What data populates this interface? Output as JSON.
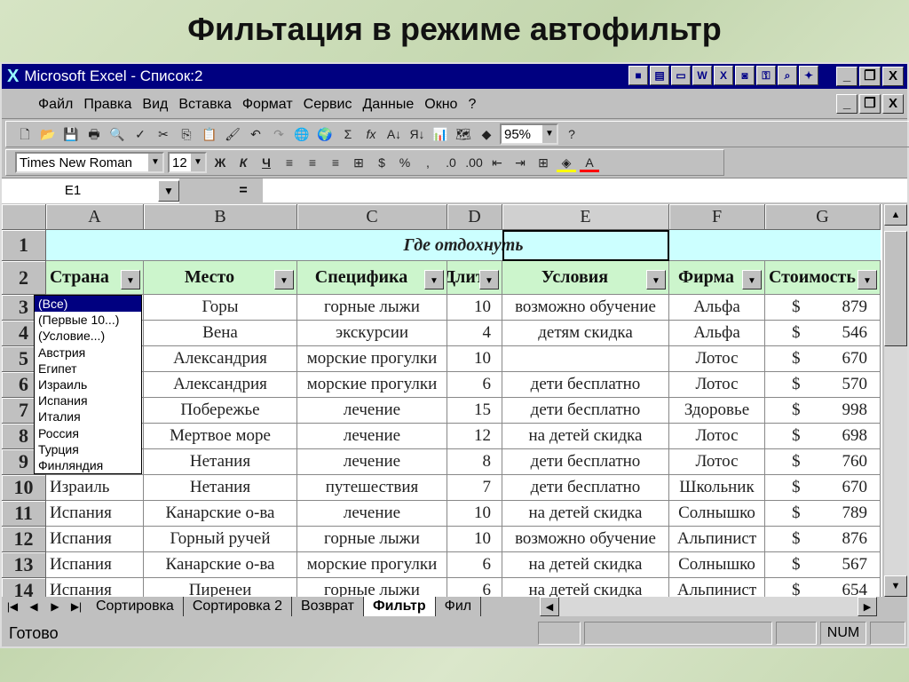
{
  "slide_title": "Фильтация в режиме автофильтр",
  "window": {
    "title": "Microsoft Excel - Список:2"
  },
  "menu": [
    "Файл",
    "Правка",
    "Вид",
    "Вставка",
    "Формат",
    "Сервис",
    "Данные",
    "Окно",
    "?"
  ],
  "toolbar": {
    "zoom": "95%",
    "font": "Times New Roman",
    "size": "12",
    "bold": "Ж",
    "italic": "К",
    "underline": "Ч",
    "percent": "%",
    "comma": ",",
    "sigma": "Σ",
    "fx": "fx"
  },
  "formula_bar": {
    "name_box": "E1",
    "equals": "=",
    "value": ""
  },
  "columns": [
    "A",
    "B",
    "C",
    "D",
    "E",
    "F",
    "G"
  ],
  "table_title": "Где отдохнуть",
  "headers": [
    "Страна",
    "Место",
    "Специфика",
    "Длит",
    "Условия",
    "Фирма",
    "Стоимость"
  ],
  "rows": [
    [
      "",
      "Горы",
      "горные лыжи",
      "10",
      "возможно обучение",
      "Альфа",
      "$",
      "879"
    ],
    [
      "",
      "Вена",
      "экскурсии",
      "4",
      "детям скидка",
      "Альфа",
      "$",
      "546"
    ],
    [
      "",
      "Александрия",
      "морские прогулки",
      "10",
      "",
      "Лотос",
      "$",
      "670"
    ],
    [
      "",
      "Александрия",
      "морские прогулки",
      "6",
      "дети бесплатно",
      "Лотос",
      "$",
      "570"
    ],
    [
      "",
      "Побережье",
      "лечение",
      "15",
      "дети бесплатно",
      "Здоровье",
      "$",
      "998"
    ],
    [
      "",
      "Мертвое море",
      "лечение",
      "12",
      "на детей скидка",
      "Лотос",
      "$",
      "698"
    ],
    [
      "",
      "Нетания",
      "лечение",
      "8",
      "дети бесплатно",
      "Лотос",
      "$",
      "760"
    ],
    [
      "Израиль",
      "Нетания",
      "путешествия",
      "7",
      "дети бесплатно",
      "Школьник",
      "$",
      "670"
    ],
    [
      "Испания",
      "Канарские о-ва",
      "лечение",
      "10",
      "на детей скидка",
      "Солнышко",
      "$",
      "789"
    ],
    [
      "Испания",
      "Горный ручей",
      "горные лыжи",
      "10",
      "возможно обучение",
      "Альпинист",
      "$",
      "876"
    ],
    [
      "Испания",
      "Канарские о-ва",
      "морские прогулки",
      "6",
      "на детей скидка",
      "Солнышко",
      "$",
      "567"
    ],
    [
      "Испания",
      "Пиренеи",
      "горные лыжи",
      "6",
      "на детей скидка",
      "Альпинист",
      "$",
      "654"
    ]
  ],
  "dropdown": {
    "selected": "(Все)",
    "items": [
      "(Все)",
      "(Первые 10...)",
      "(Условие...)",
      "Австрия",
      "Египет",
      "Израиль",
      "Испания",
      "Италия",
      "Россия",
      "Турция",
      "Финляндия"
    ]
  },
  "sheet_tabs": [
    {
      "label": "Сортировка"
    },
    {
      "label": "Сортировка 2"
    },
    {
      "label": "Возврат"
    },
    {
      "label": "Фильтр",
      "active": true
    },
    {
      "label": "Фил"
    }
  ],
  "status": {
    "text": "Готово",
    "num": "NUM"
  },
  "colors": {
    "title_bar": "#000080",
    "header_fill": "#ccf5cc",
    "title_fill": "#ccffff"
  }
}
